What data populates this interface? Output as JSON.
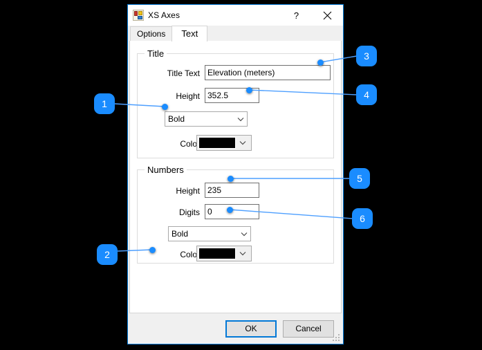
{
  "window": {
    "title": "XS Axes",
    "icon": "form-window-icon",
    "help_label": "?",
    "close_label": "✕"
  },
  "tabs": [
    {
      "label": "Options",
      "active": false
    },
    {
      "label": "Text",
      "active": true
    }
  ],
  "title_group": {
    "legend": "Title",
    "title_text_label": "Title Text",
    "title_text_value": "Elevation (meters)",
    "height_label": "Height",
    "height_value": "352.5",
    "font_style_value": "Bold",
    "color_label": "Color",
    "color_value": "#000000"
  },
  "numbers_group": {
    "legend": "Numbers",
    "height_label": "Height",
    "height_value": "235",
    "digits_label": "Digits",
    "digits_value": "0",
    "font_style_value": "Bold",
    "color_label": "Color",
    "color_value": "#000000"
  },
  "footer": {
    "ok_label": "OK",
    "cancel_label": "Cancel"
  },
  "annotations": {
    "accent_color": "#1a8cff",
    "markers": [
      {
        "label": "1"
      },
      {
        "label": "2"
      },
      {
        "label": "3"
      },
      {
        "label": "4"
      },
      {
        "label": "5"
      },
      {
        "label": "6"
      }
    ]
  }
}
